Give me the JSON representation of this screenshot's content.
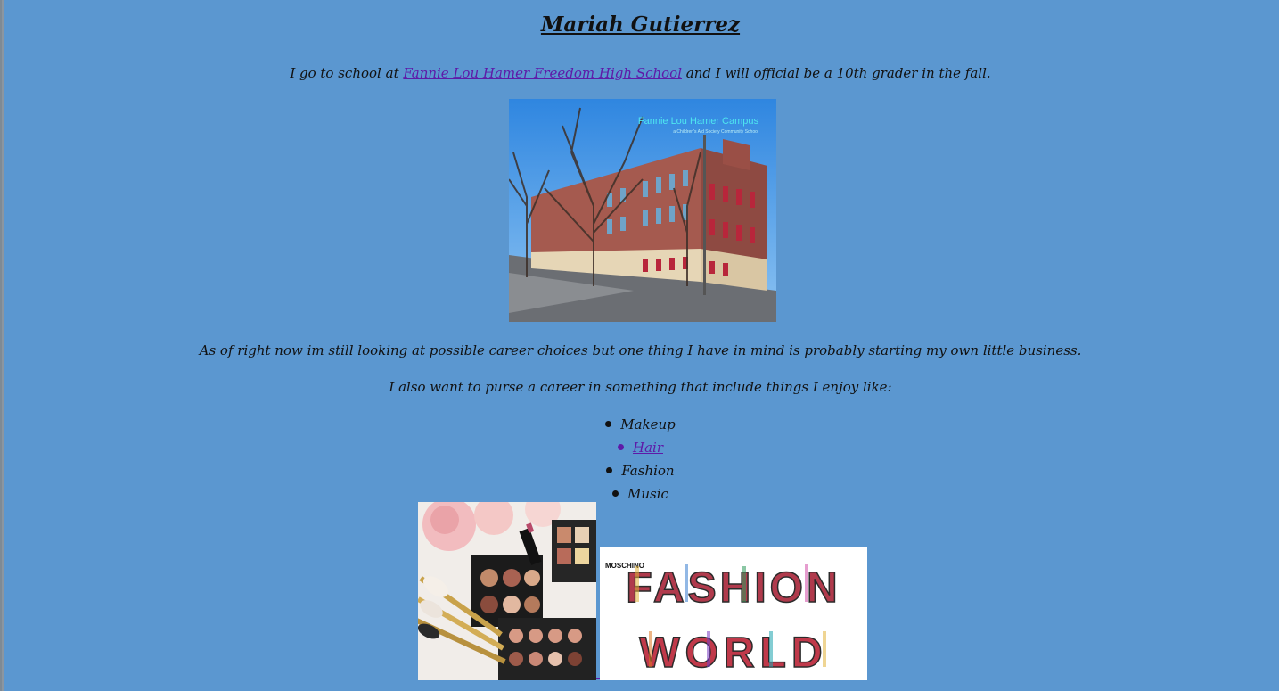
{
  "page": {
    "title": "Mariah Gutierrez",
    "intro": {
      "before": "I go to school at ",
      "link_text": "Fannie Lou Hamer Freedom High School",
      "after": " and I will official be a 10th grader in the fall."
    },
    "school_image": {
      "overlay_title": "Fannie Lou Hamer Campus",
      "overlay_subtitle": "a Children's Aid Society Community School"
    },
    "career_text": "As of right now im still looking at possible career choices but one thing I have in mind is probably starting my own little business.",
    "interests_intro": "I also want to purse a career in something that include things I enjoy like:",
    "interests": [
      {
        "label": "Makeup",
        "is_link": false
      },
      {
        "label": "Hair",
        "is_link": true
      },
      {
        "label": "Fashion",
        "is_link": false
      },
      {
        "label": "Music",
        "is_link": false
      }
    ],
    "fashion_image": {
      "logo_text": "MOSCHINO",
      "words": [
        "FASHION",
        "WORLD"
      ]
    }
  },
  "colors": {
    "background": "#5b97d0",
    "link": "#5e1aa8",
    "text": "#111111"
  }
}
